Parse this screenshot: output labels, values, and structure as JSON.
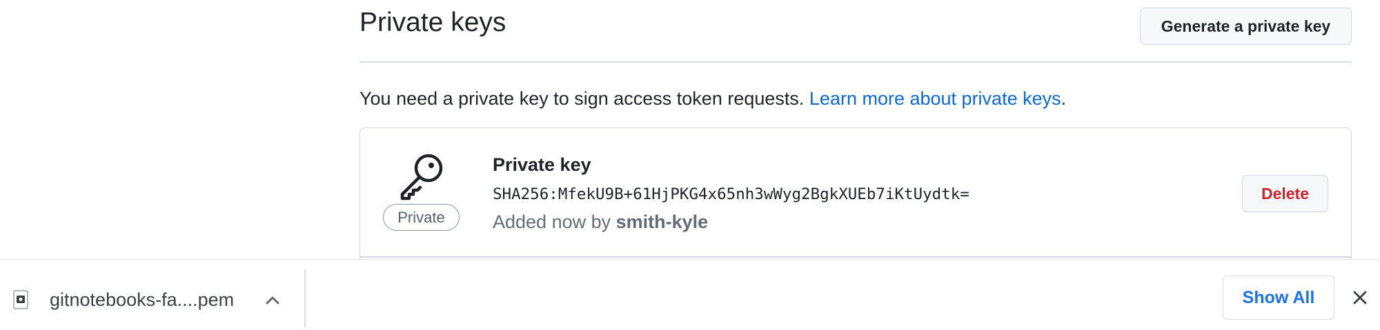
{
  "header": {
    "title": "Private keys",
    "generate_button_label": "Generate a private key"
  },
  "intro": {
    "text": "You need a private key to sign access token requests. ",
    "link_label": "Learn more about private keys",
    "suffix": "."
  },
  "key_item": {
    "icon": "key-icon",
    "badge_label": "Private",
    "title": "Private key",
    "fingerprint": "SHA256:MfekU9B+61HjPKG4x65nh3wWyg2BgkXUEb7iKtUydtk=",
    "added_prefix": "Added now by ",
    "added_by": "smith-kyle",
    "delete_button_label": "Delete"
  },
  "download_shelf": {
    "file_icon": "pem-file-icon",
    "file_name": "gitnotebooks-fa....pem",
    "expand_icon": "chevron-up-icon",
    "show_all_label": "Show All",
    "close_icon": "close-icon"
  },
  "colors": {
    "link": "#0969da",
    "danger": "#cf222e",
    "chrome_blue": "#1a73e8",
    "text_primary": "#1f2328",
    "text_muted": "#636c76",
    "border": "#d0d7de"
  }
}
